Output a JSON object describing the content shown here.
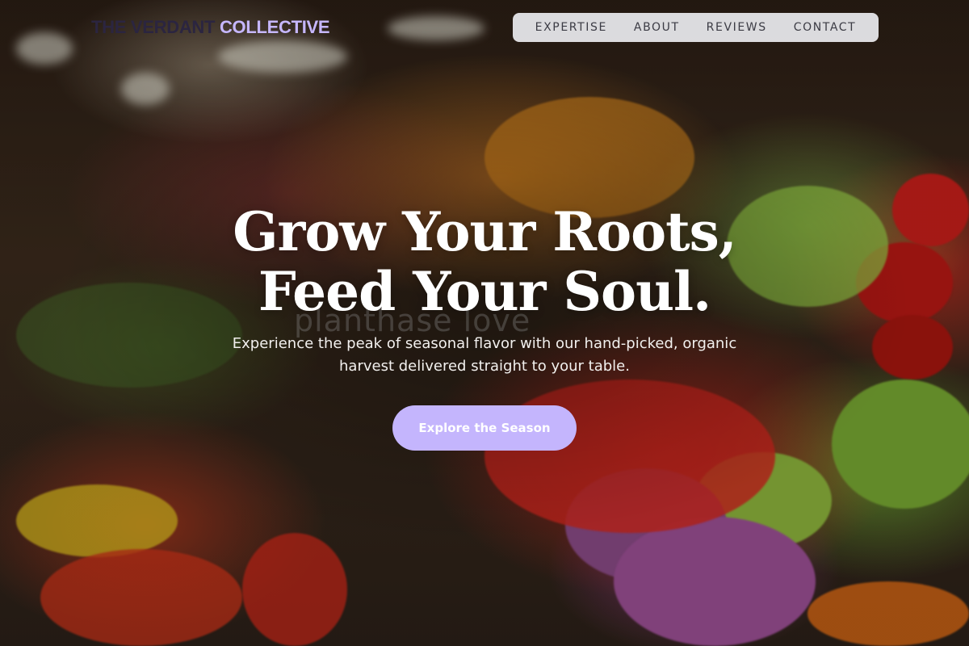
{
  "brand": {
    "part1": "THE VERDANT ",
    "part2": "COLLECTIVE"
  },
  "nav": [
    {
      "label": "EXPERTISE"
    },
    {
      "label": "ABOUT"
    },
    {
      "label": "REVIEWS"
    },
    {
      "label": "CONTACT"
    }
  ],
  "hero": {
    "title_line1": "Grow Your Roots,",
    "title_line2": "Feed Your Soul.",
    "subtitle": "Experience the peak of seasonal flavor with our hand-picked, organic harvest delivered straight to your table.",
    "cta_label": "Explore the Season"
  },
  "background": {
    "watermark": "planthase love"
  },
  "colors": {
    "accent": "#c4b5fd",
    "brand_dark": "#2b2540",
    "brand_light": "#c6b7ff"
  }
}
